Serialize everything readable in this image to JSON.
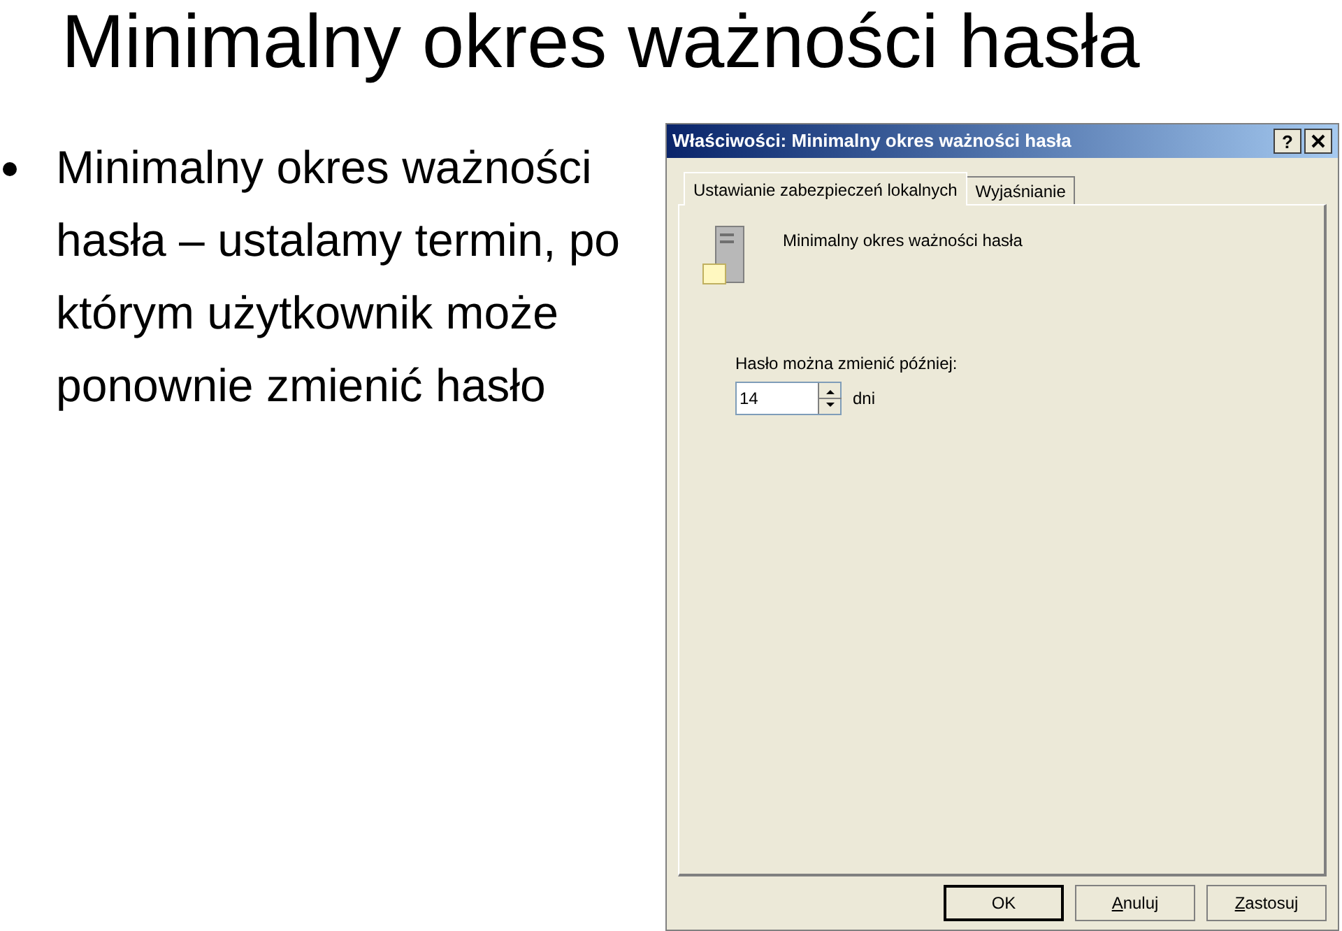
{
  "slide": {
    "title": "Minimalny okres ważności hasła",
    "bullets": [
      "Minimalny okres ważności hasła – ustalamy termin, po którym użytkownik może ponownie zmienić hasło"
    ]
  },
  "dialog": {
    "title": "Właściwości: Minimalny okres ważności hasła",
    "help_button": "?",
    "tabs": [
      {
        "label": "Ustawianie zabezpieczeń lokalnych",
        "selected": true
      },
      {
        "label": "Wyjaśnianie",
        "selected": false
      }
    ],
    "policy_name": "Minimalny okres ważności hasła",
    "field": {
      "label": "Hasło można zmienić później:",
      "value": "14",
      "unit": "dni"
    },
    "buttons": [
      {
        "label": "OK",
        "default": true
      },
      {
        "label": "Anuluj",
        "default": false
      },
      {
        "label": "Zastosuj",
        "default": false
      }
    ]
  }
}
